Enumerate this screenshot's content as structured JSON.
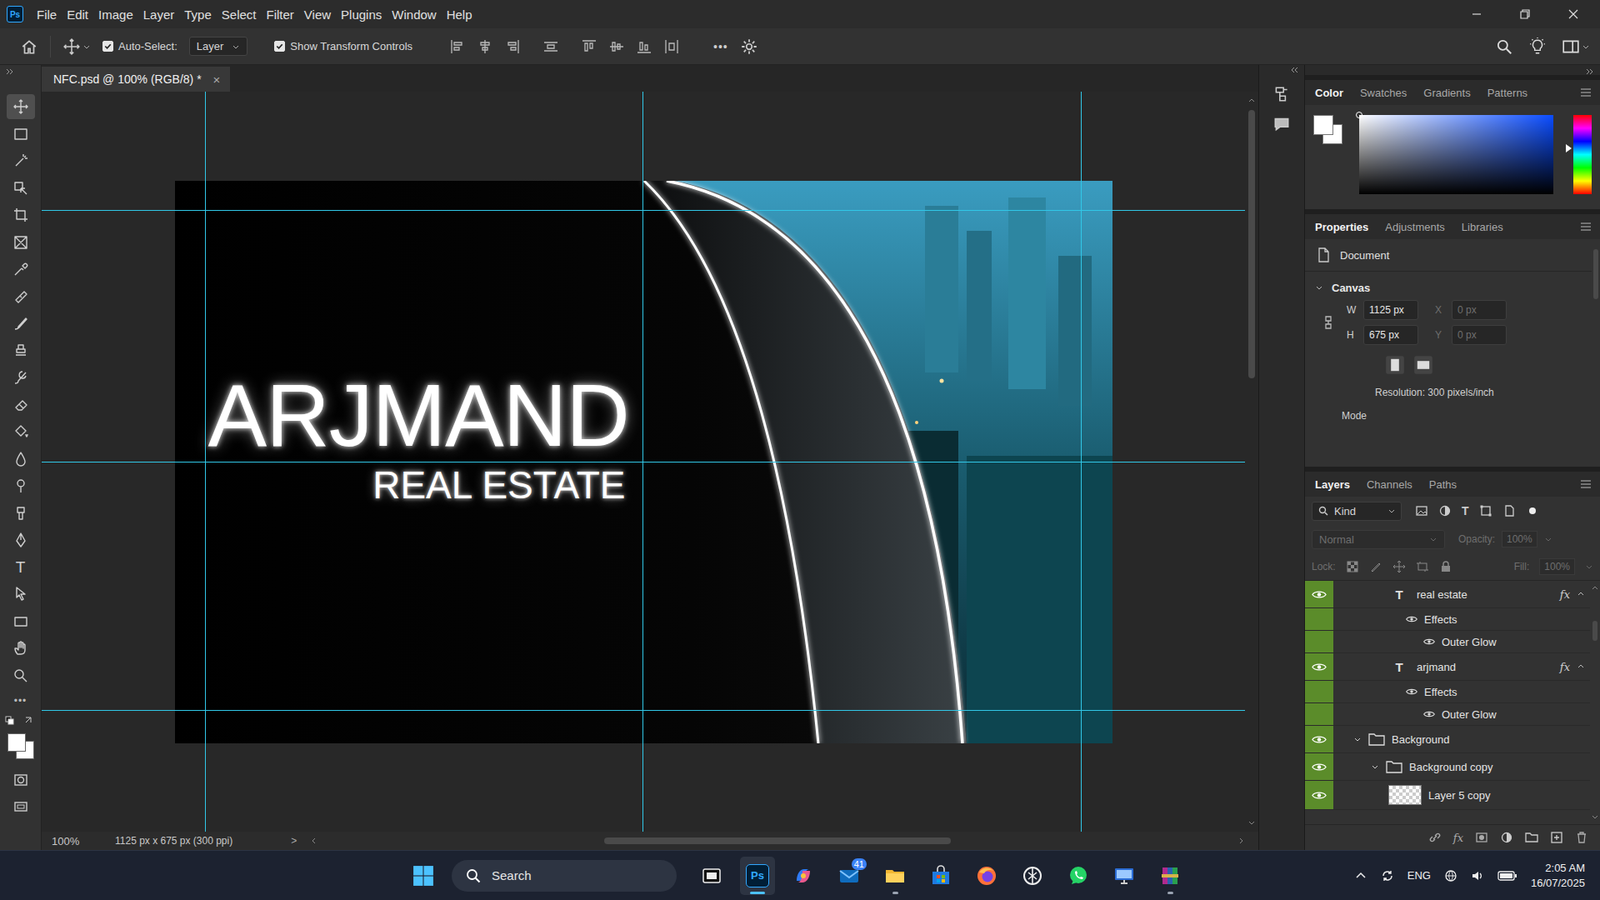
{
  "app": {
    "logo": "Ps"
  },
  "menu": [
    "File",
    "Edit",
    "Image",
    "Layer",
    "Type",
    "Select",
    "Filter",
    "View",
    "Plugins",
    "Window",
    "Help"
  ],
  "options_bar": {
    "auto_select": {
      "label": "Auto-Select:",
      "checked": true
    },
    "target": "Layer",
    "show_transform": {
      "label": "Show Transform Controls",
      "checked": true
    },
    "more": "•••"
  },
  "document_tab": {
    "title": "NFC.psd @ 100% (RGB/8) *",
    "close": "×",
    "selected": true
  },
  "tools": [
    {
      "selected": true
    },
    {
      "selected": false
    },
    {
      "selected": false
    },
    {
      "selected": false
    },
    {
      "selected": false
    },
    {
      "selected": false
    },
    {
      "selected": false
    },
    {
      "selected": false
    },
    {
      "selected": false
    },
    {
      "selected": false
    },
    {
      "selected": false
    },
    {
      "selected": false
    },
    {
      "selected": false
    },
    {
      "selected": false
    },
    {
      "selected": false
    },
    {
      "selected": false
    },
    {
      "selected": false
    },
    {
      "selected": false,
      "glyph": "T"
    },
    {
      "selected": false
    },
    {
      "selected": false
    },
    {
      "selected": false
    },
    {
      "selected": false
    }
  ],
  "tools_more": "•••",
  "canvas": {
    "headline": "ARJMAND",
    "subline": "REAL ESTATE"
  },
  "status_bar": {
    "zoom": "100%",
    "info": "1125 px x 675 px (300 ppi)",
    "arrow": ">"
  },
  "color_panel": {
    "tabs": [
      {
        "label": "Color",
        "selected": true
      },
      {
        "label": "Swatches",
        "selected": false
      },
      {
        "label": "Gradients",
        "selected": false
      },
      {
        "label": "Patterns",
        "selected": false
      }
    ],
    "hue": {
      "level": 0.42
    }
  },
  "properties": {
    "tabs": [
      {
        "label": "Properties",
        "selected": true
      },
      {
        "label": "Adjustments",
        "selected": false
      },
      {
        "label": "Libraries",
        "selected": false
      }
    ],
    "section": "Document",
    "group": {
      "label": "Canvas",
      "expanded": true
    },
    "fields": [
      {
        "label": "W",
        "value": "1125 px",
        "disabled": false
      },
      {
        "label": "X",
        "value": "0 px",
        "disabled": true
      },
      {
        "label": "H",
        "value": "675 px",
        "disabled": false
      },
      {
        "label": "Y",
        "value": "0 px",
        "disabled": true
      }
    ],
    "resolution": "Resolution: 300 pixels/inch",
    "mode": "Mode"
  },
  "layers_panel": {
    "tabs": [
      {
        "label": "Layers",
        "selected": true
      },
      {
        "label": "Channels",
        "selected": false
      },
      {
        "label": "Paths",
        "selected": false
      }
    ],
    "filter": "Kind",
    "filter_glyph": "T",
    "blend_mode": "Normal",
    "opacity_label": "Opacity:",
    "opacity": "100%",
    "lock_label": "Lock:",
    "fill_label": "Fill:",
    "fill": "100%",
    "controls_disabled": true,
    "rows": [
      {
        "kind": "text",
        "name": "real estate",
        "depth": 2,
        "visible": true,
        "color": "#5b8c2a",
        "icon": "T",
        "fx": "fx",
        "expanded": true
      },
      {
        "kind": "effects",
        "name": "Effects",
        "depth": 3,
        "visible": true,
        "color": "#5b8c2a"
      },
      {
        "kind": "effect",
        "name": "Outer Glow",
        "depth": 4,
        "visible": true,
        "color": "#5b8c2a"
      },
      {
        "kind": "text",
        "name": "arjmand",
        "depth": 2,
        "visible": true,
        "color": "#5b8c2a",
        "icon": "T",
        "fx": "fx",
        "expanded": true
      },
      {
        "kind": "effects",
        "name": "Effects",
        "depth": 3,
        "visible": true,
        "color": "#5b8c2a"
      },
      {
        "kind": "effect",
        "name": "Outer Glow",
        "depth": 4,
        "visible": true,
        "color": "#5b8c2a"
      },
      {
        "kind": "group",
        "name": "Background",
        "depth": 0,
        "visible": true,
        "color": "#5b8c2a",
        "expanded": true
      },
      {
        "kind": "group",
        "name": "Background copy",
        "depth": 1,
        "visible": true,
        "color": "#5b8c2a",
        "expanded": true
      },
      {
        "kind": "pixel",
        "name": "Layer 5 copy",
        "depth": 2,
        "visible": true,
        "color": "#5b8c2a"
      }
    ],
    "footer_fx": "fx"
  },
  "taskbar": {
    "search": "Search",
    "apps": [
      {
        "kind": "taskview",
        "running": false,
        "active": false
      },
      {
        "kind": "photoshop",
        "running": true,
        "active": true
      },
      {
        "kind": "copilot",
        "running": false,
        "active": false
      },
      {
        "kind": "mail",
        "running": false,
        "active": false,
        "badge": "41"
      },
      {
        "kind": "explorer",
        "running": true,
        "active": false
      },
      {
        "kind": "store",
        "running": false,
        "active": false
      },
      {
        "kind": "firefox",
        "running": false,
        "active": false
      },
      {
        "kind": "chatgpt",
        "running": false,
        "active": false
      },
      {
        "kind": "whatsapp",
        "running": false,
        "active": false
      },
      {
        "kind": "remote",
        "running": false,
        "active": false
      },
      {
        "kind": "winrar",
        "running": true,
        "active": false
      }
    ],
    "language": "ENG",
    "time": "2:05 AM",
    "date": "16/07/2025"
  }
}
